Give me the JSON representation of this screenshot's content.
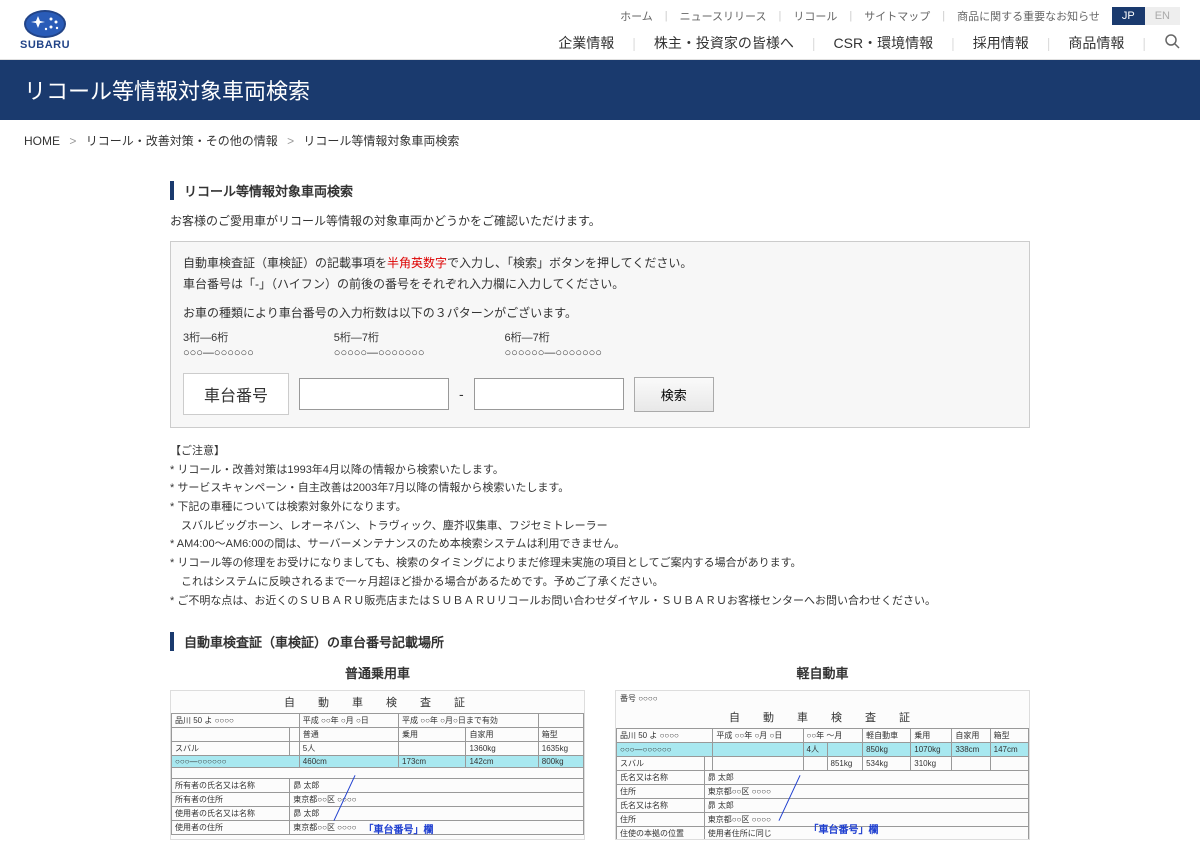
{
  "brand": "SUBARU",
  "top_links": [
    "ホーム",
    "ニュースリリース",
    "リコール",
    "サイトマップ",
    "商品に関する重要なお知らせ"
  ],
  "lang": {
    "jp": "JP",
    "en": "EN"
  },
  "main_nav": [
    "企業情報",
    "株主・投資家の皆様へ",
    "CSR・環境情報",
    "採用情報",
    "商品情報"
  ],
  "page_title": "リコール等情報対象車両検索",
  "breadcrumb": [
    "HOME",
    "リコール・改善対策・その他の情報",
    "リコール等情報対象車両検索"
  ],
  "section1_heading": "リコール等情報対象車両検索",
  "intro": "お客様のご愛用車がリコール等情報の対象車両かどうかをご確認いただけます。",
  "instruction1_pre": "自動車検査証（車検証）の記載事項を",
  "instruction1_red": "半角英数字",
  "instruction1_post": "で入力し、「検索」ボタンを押してください。",
  "instruction2": "車台番号は「-」（ハイフン）の前後の番号をそれぞれ入力欄に入力してください。",
  "pattern_intro": "お車の種類により車台番号の入力桁数は以下の３パターンがございます。",
  "patterns": [
    {
      "label": "3桁―6桁",
      "example": "○○○―○○○○○○"
    },
    {
      "label": "5桁―7桁",
      "example": "○○○○○―○○○○○○○"
    },
    {
      "label": "6桁―7桁",
      "example": "○○○○○○―○○○○○○○"
    }
  ],
  "search_label": "車台番号",
  "search_hyphen": "-",
  "search_btn": "検索",
  "notes_title": "【ご注意】",
  "notes": [
    "* リコール・改善対策は1993年4月以降の情報から検索いたします。",
    "* サービスキャンペーン・自主改善は2003年7月以降の情報から検索いたします。",
    "* 下記の車種については検索対象外になります。",
    "　スバルビッグホーン、レオーネバン、トラヴィック、塵芥収集車、フジセミトレーラー",
    "* AM4:00～AM6:00の間は、サーバーメンテナンスのため本検索システムは利用できません。",
    "* リコール等の修理をお受けになりましても、検索のタイミングによりまだ修理未実施の項目としてご案内する場合があります。",
    "　これはシステムに反映されるまで一ヶ月超ほど掛かる場合があるためです。予めご了承ください。",
    "* ご不明な点は、お近くのＳＵＢＡＲＵ販売店またはＳＵＢＡＲＵリコールお問い合わせダイヤル・ＳＵＢＡＲＵお客様センターへお問い合わせください。"
  ],
  "section2_heading": "自動車検査証（車検証）の車台番号記載場所",
  "cert_titles": [
    "普通乗用車",
    "軽自動車"
  ],
  "cert_doc_title": "自　動　車　検　査　証",
  "callout": "「車台番号」欄"
}
